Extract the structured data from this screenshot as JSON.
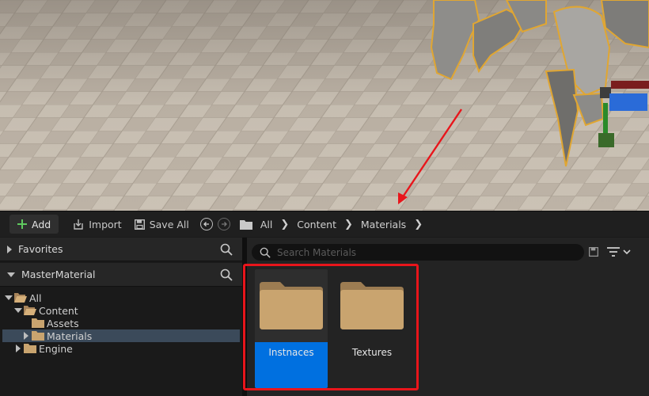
{
  "toolbar": {
    "add_label": "Add",
    "import_label": "Import",
    "save_all_label": "Save All",
    "breadcrumbs": [
      "All",
      "Content",
      "Materials"
    ]
  },
  "favorites": {
    "label": "Favorites"
  },
  "tree_panel": {
    "label": "MasterMaterial",
    "items": [
      {
        "label": "All"
      },
      {
        "label": "Content"
      },
      {
        "label": "Assets"
      },
      {
        "label": "Materials"
      },
      {
        "label": "Engine"
      }
    ]
  },
  "content": {
    "search_placeholder": "Search Materials",
    "folders": [
      {
        "name": "Instnaces",
        "selected": true
      },
      {
        "name": "Textures",
        "selected": false
      }
    ]
  },
  "colors": {
    "selection": "#0070e0",
    "annotation": "#e8151b",
    "folder": "#c9a46f",
    "tree_selection": "#3b4a5a"
  }
}
